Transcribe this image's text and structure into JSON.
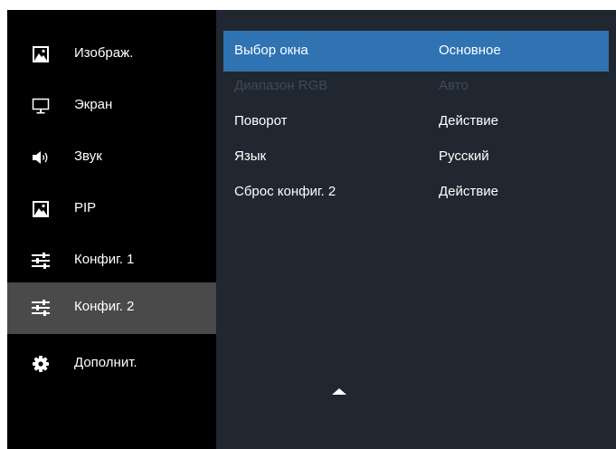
{
  "sidebar": {
    "items": [
      {
        "label": "Изображ.",
        "icon": "picture-icon"
      },
      {
        "label": "Экран",
        "icon": "monitor-icon"
      },
      {
        "label": "Звук",
        "icon": "speaker-icon"
      },
      {
        "label": "PIP",
        "icon": "picture-icon"
      },
      {
        "label": "Конфиг. 1",
        "icon": "sliders-icon"
      },
      {
        "label": "Конфиг. 2",
        "icon": "sliders-icon"
      },
      {
        "label": "Дополнит.",
        "icon": "gear-icon"
      }
    ],
    "selected": "Конфиг. 2"
  },
  "panel": {
    "rows": [
      {
        "name": "Выбор окна",
        "value": "Основное"
      },
      {
        "name": "Диапазон RGB",
        "value": "Авто"
      },
      {
        "name": "Поворот",
        "value": "Действие"
      },
      {
        "name": "Язык",
        "value": "Русский"
      },
      {
        "name": "Сброс конфиг. 2",
        "value": "Действие"
      }
    ],
    "highlighted_row": "Выбор окна",
    "disabled_row": "Диапазон RGB",
    "scroll_indicator_icon": "triangle-up-icon"
  },
  "colors": {
    "sidebar_bg": "#000000",
    "sidebar_selected_bg": "#4a4a4a",
    "panel_bg": "#202730",
    "highlight_bg": "#2f73b3",
    "disabled_text": "#3e4a56"
  }
}
